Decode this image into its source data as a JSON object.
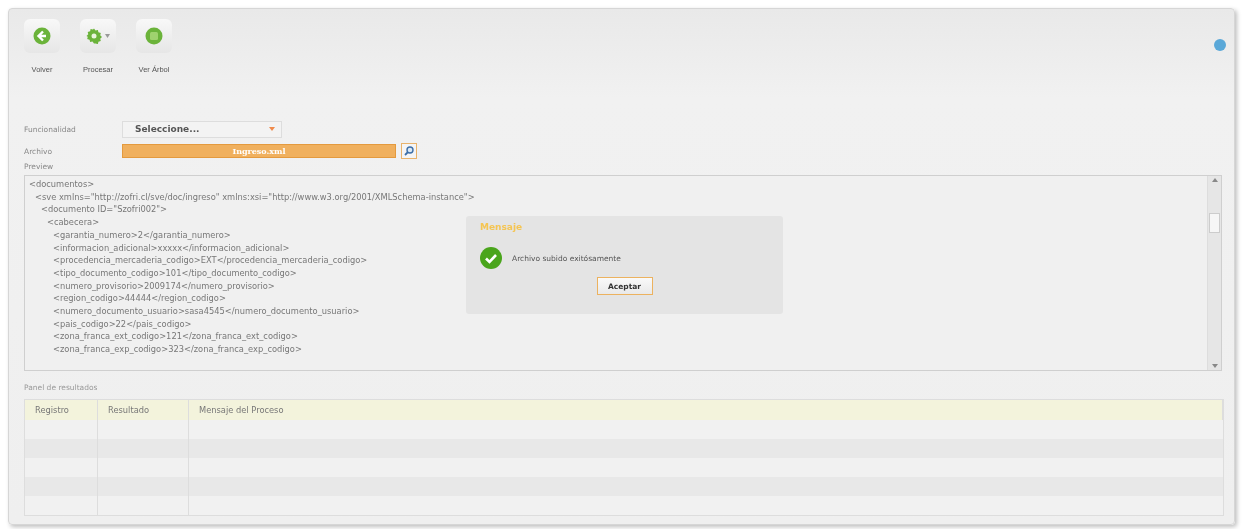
{
  "toolbar": [
    {
      "kind": "back",
      "label": "Volver",
      "has_menu": false
    },
    {
      "kind": "gear",
      "label": "Procesar",
      "has_menu": true
    },
    {
      "kind": "tree",
      "label": "Ver Árbol",
      "has_menu": false
    }
  ],
  "form": {
    "funcionalidad": {
      "label": "Funcionalidad",
      "value": "Seleccione..."
    },
    "archivo": {
      "label": "Archivo",
      "value": "Ingreso.xml"
    },
    "preview": {
      "label": "Preview",
      "lines": [
        {
          "text": "<documentos>",
          "children": [
            {
              "text": "<sve xmlns=\"http://zofri.cl/sve/doc/ingreso\" xmlns:xsi=\"http://www.w3.org/2001/XMLSchema-instance\">",
              "children": [
                {
                  "text": "<documento ID=\"Szofri002\">",
                  "children": [
                    {
                      "text": "<cabecera>",
                      "children": [
                        {
                          "text": "<garantia_numero>2</garantia_numero>"
                        },
                        {
                          "text": "<informacion_adicional>xxxxx</informacion_adicional>"
                        },
                        {
                          "text": "<procedencia_mercaderia_codigo>EXT</procedencia_mercaderia_codigo>"
                        },
                        {
                          "text": "<tipo_documento_codigo>101</tipo_documento_codigo>"
                        },
                        {
                          "text": "<numero_provisorio>2009174</numero_provisorio>"
                        },
                        {
                          "text": "<region_codigo>44444</region_codigo>"
                        },
                        {
                          "text": "<numero_documento_usuario>sasa4545</numero_documento_usuario>"
                        },
                        {
                          "text": "<pais_codigo>22</pais_codigo>"
                        },
                        {
                          "text": "<zona_franca_ext_codigo>121</zona_franca_ext_codigo>"
                        },
                        {
                          "text": "<zona_franca_exp_codigo>323</zona_franca_exp_codigo>"
                        }
                      ]
                    }
                  ]
                }
              ]
            }
          ]
        }
      ]
    }
  },
  "dialog": {
    "title": "Mensaje",
    "message": "Archivo subido exitósamente",
    "button": "Aceptar"
  },
  "results": {
    "title": "Panel de resultados",
    "columns": [
      "Registro",
      "Resultado",
      "Mensaje del Proceso"
    ]
  }
}
